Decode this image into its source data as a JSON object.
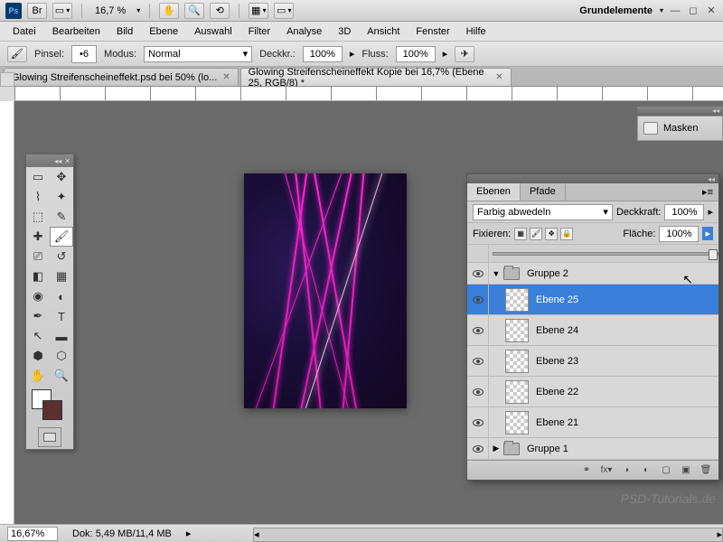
{
  "topbar": {
    "zoom": "16,7 %",
    "workspace": "Grundelemente"
  },
  "menu": [
    "Datei",
    "Bearbeiten",
    "Bild",
    "Ebene",
    "Auswahl",
    "Filter",
    "Analyse",
    "3D",
    "Ansicht",
    "Fenster",
    "Hilfe"
  ],
  "options": {
    "pinsel_label": "Pinsel:",
    "pinsel_size": "6",
    "modus_label": "Modus:",
    "modus_value": "Normal",
    "deckkr_label": "Deckkr.:",
    "deckkr_value": "100%",
    "fluss_label": "Fluss:",
    "fluss_value": "100%"
  },
  "tabs": [
    {
      "label": "Glowing Streifenscheineffekt.psd bei 50% (lo...",
      "active": false
    },
    {
      "label": "Glowing Streifenscheineffekt Kopie bei 16,7% (Ebene 25, RGB/8) *",
      "active": true
    }
  ],
  "right_collapsed": {
    "masken": "Masken"
  },
  "layers": {
    "tab_ebenen": "Ebenen",
    "tab_pfade": "Pfade",
    "blend_mode": "Farbig abwedeln",
    "deckkraft_label": "Deckkraft:",
    "deckkraft_value": "100%",
    "fixieren_label": "Fixieren:",
    "flaeche_label": "Fläche:",
    "flaeche_value": "100%",
    "items": [
      {
        "type": "group",
        "name": "Gruppe 2",
        "expanded": true
      },
      {
        "type": "layer",
        "name": "Ebene 25",
        "selected": true
      },
      {
        "type": "layer",
        "name": "Ebene 24"
      },
      {
        "type": "layer",
        "name": "Ebene 23"
      },
      {
        "type": "layer",
        "name": "Ebene 22"
      },
      {
        "type": "layer",
        "name": "Ebene 21"
      },
      {
        "type": "group",
        "name": "Gruppe 1",
        "expanded": false
      }
    ]
  },
  "status": {
    "zoom": "16,67%",
    "dok_label": "Dok:",
    "dok_value": "5,49 MB/11,4 MB"
  },
  "watermark": "PSD-Tutorials.de"
}
